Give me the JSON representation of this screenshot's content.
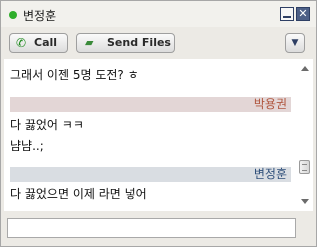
{
  "window": {
    "title": "변정훈",
    "status_color": "#2fae2b",
    "minimize_icon": "minimize-icon",
    "close_icon": "close-icon",
    "close_glyph": "✕"
  },
  "toolbar": {
    "call_label": "Call",
    "call_icon": "phone-icon",
    "send_files_label": "Send Files",
    "send_files_icon": "send-files-icon",
    "menu_icon": "chevron-down-icon",
    "menu_glyph": "▼"
  },
  "chat": {
    "messages_top": [
      "그래서 이젠 5명 도전? ㅎ"
    ],
    "block_a": {
      "sender": "박용권",
      "lines": [
        "다 끓었어 ㅋㅋ",
        "냠냠..;"
      ]
    },
    "block_b": {
      "sender": "변정훈",
      "lines": [
        "다 끓었으면 이제 라면 넣어"
      ]
    }
  },
  "input": {
    "value": "",
    "placeholder": ""
  }
}
